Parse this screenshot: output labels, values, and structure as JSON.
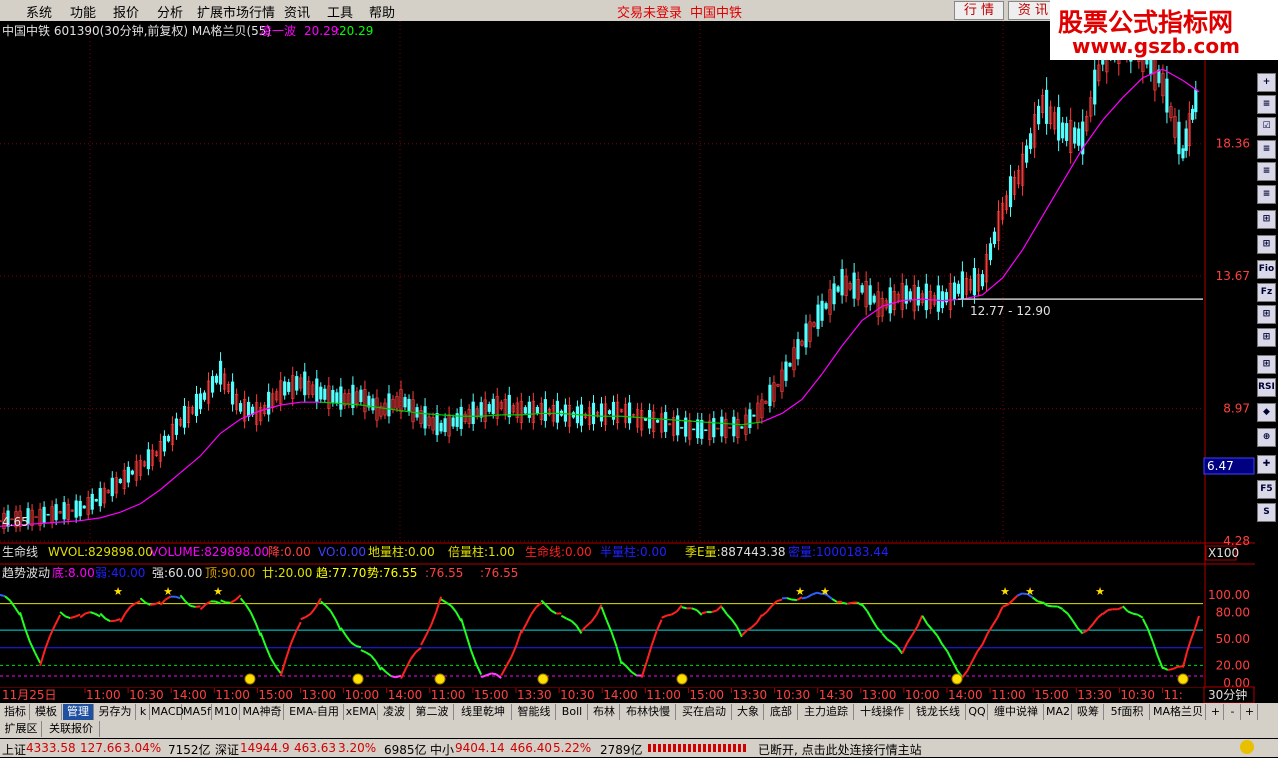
{
  "menu": {
    "items": [
      "系统",
      "功能",
      "报价",
      "分析",
      "扩展市场行情",
      "资讯",
      "工具",
      "帮助"
    ],
    "status_text": "交易未登录",
    "stock_name_top": "中国中铁",
    "buttons": [
      "行 情",
      "资 讯"
    ]
  },
  "watermark": {
    "title": "股票公式指标网",
    "url": "www.gszb.com"
  },
  "main_chart": {
    "title": "中国中铁 601390(30分钟,前复权) MA格兰贝(55)",
    "indicator_name": "凌一波",
    "indicator_values": [
      "20.29",
      "20.29"
    ],
    "y_labels": [
      "18.36",
      "13.67",
      "8.97",
      "4.28"
    ],
    "current_price_label": "6.47",
    "low_label": "4.65",
    "range_label": "12.77 - 12.90",
    "colors": {
      "up": "#ff3c3c",
      "down": "#54ffff",
      "ma_magenta": "#ff00ff",
      "ma_green": "#00cc00"
    }
  },
  "chart_data": [
    {
      "type": "line",
      "title": "中国中铁 601390(30分钟,前复权) MA格兰贝(55)",
      "x": [
        0,
        20,
        40,
        60,
        80,
        100,
        120,
        140,
        160,
        180,
        200,
        220,
        240,
        260,
        280,
        300,
        320,
        340,
        360,
        380,
        400,
        420,
        440,
        460,
        480,
        500,
        520,
        540,
        560,
        580,
        600,
        620,
        640,
        660,
        680,
        700,
        720,
        740,
        760,
        780,
        800,
        820,
        840,
        860,
        880,
        900,
        920,
        940,
        960,
        980,
        1000,
        1020,
        1040,
        1060,
        1080,
        1100,
        1120,
        1140,
        1160,
        1180,
        1196
      ],
      "ylim": [
        4.28,
        22.0
      ],
      "series": [
        {
          "name": "price",
          "values": [
            5.0,
            5.1,
            5.15,
            5.3,
            5.4,
            5.8,
            6.4,
            6.9,
            7.5,
            8.5,
            9.2,
            10.2,
            9.0,
            8.8,
            9.6,
            9.9,
            9.5,
            9.3,
            9.4,
            8.9,
            9.3,
            8.7,
            8.3,
            8.6,
            8.9,
            9.1,
            8.9,
            8.9,
            8.8,
            8.7,
            8.8,
            8.9,
            8.6,
            8.5,
            8.3,
            8.2,
            8.3,
            8.3,
            9.0,
            10.0,
            11.3,
            12.4,
            13.4,
            13.2,
            12.6,
            13.0,
            12.9,
            12.8,
            13.3,
            13.5,
            16.0,
            17.5,
            19.8,
            18.8,
            18.5,
            21.5,
            22.0,
            21.6,
            20.5,
            18.0,
            20.3
          ]
        },
        {
          "name": "MA格兰贝(55)",
          "values": [
            4.8,
            4.85,
            4.9,
            4.95,
            5.0,
            5.1,
            5.3,
            5.6,
            6.1,
            6.7,
            7.3,
            8.1,
            8.6,
            8.9,
            9.1,
            9.2,
            9.2,
            9.15,
            9.1,
            9.0,
            8.9,
            8.8,
            8.75,
            8.7,
            8.7,
            8.75,
            8.75,
            8.8,
            8.8,
            8.75,
            8.7,
            8.7,
            8.65,
            8.6,
            8.55,
            8.5,
            8.45,
            8.4,
            8.5,
            8.8,
            9.3,
            10.2,
            11.2,
            12.1,
            12.6,
            12.8,
            12.85,
            12.8,
            12.85,
            13.0,
            13.6,
            14.6,
            15.8,
            17.0,
            18.2,
            19.2,
            20.0,
            20.7,
            21.0,
            20.6,
            20.2
          ]
        }
      ]
    },
    {
      "type": "line",
      "title": "趋势波动",
      "x": [
        0,
        20,
        40,
        60,
        80,
        100,
        120,
        140,
        160,
        180,
        200,
        220,
        240,
        260,
        280,
        300,
        320,
        340,
        360,
        380,
        400,
        420,
        440,
        460,
        480,
        500,
        520,
        540,
        560,
        580,
        600,
        620,
        640,
        660,
        680,
        700,
        720,
        740,
        760,
        780,
        800,
        820,
        840,
        860,
        880,
        900,
        920,
        940,
        960,
        980,
        1000,
        1020,
        1040,
        1060,
        1080,
        1100,
        1120,
        1140,
        1160,
        1180,
        1196
      ],
      "ylim": [
        0,
        110
      ],
      "series": [
        {
          "name": "趋",
          "values": [
            100,
            80,
            20,
            80,
            75,
            78,
            70,
            95,
            90,
            98,
            85,
            92,
            98,
            55,
            10,
            70,
            95,
            60,
            40,
            15,
            8,
            40,
            98,
            70,
            10,
            5,
            60,
            90,
            80,
            55,
            90,
            20,
            10,
            70,
            90,
            75,
            90,
            50,
            80,
            92,
            100,
            98,
            95,
            85,
            60,
            30,
            80,
            40,
            10,
            40,
            90,
            98,
            95,
            80,
            60,
            75,
            90,
            70,
            20,
            15,
            80
          ]
        }
      ]
    }
  ],
  "volume_row": {
    "label": "生命线",
    "items": [
      {
        "name": "WVOL:",
        "value": "829898.00"
      },
      {
        "name": "VOLUME:",
        "value": "829898.00"
      },
      {
        "name": "降:",
        "value": "0.00"
      },
      {
        "name": "VO:",
        "value": "0.00"
      },
      {
        "name": "地量柱:",
        "value": "0.00"
      },
      {
        "name": "倍量柱:",
        "value": "1.00"
      },
      {
        "name": "生命线:",
        "value": "0.00"
      },
      {
        "name": "半量柱:",
        "value": "0.00"
      },
      {
        "name": "季E量:",
        "value": "887443.38"
      },
      {
        "name": "密量:",
        "value": "1000183.44"
      }
    ],
    "x_button": "X100"
  },
  "wave_row": {
    "label": "趋势波动",
    "items": [
      {
        "name": "底:",
        "value": "8.00"
      },
      {
        "name": "弱:",
        "value": "40.00"
      },
      {
        "name": "强:",
        "value": "60.00"
      },
      {
        "name": "顶:",
        "value": "90.00"
      },
      {
        "name": "廿:",
        "value": "20.00"
      },
      {
        "name": "趋:",
        "value": "77.70"
      },
      {
        "name": "势:",
        "value": "76.55"
      },
      {
        "name": ":",
        "value": "76.55"
      },
      {
        "name": ":",
        "value": "76.55"
      }
    ],
    "y_labels": [
      "100.00",
      "80.00",
      "50.00",
      "20.00",
      "0.00"
    ]
  },
  "time_axis": {
    "date_label": "11月25日",
    "ticks": [
      "11:00",
      "10:30",
      "14:00",
      "11:00",
      "15:00",
      "13:00",
      "10:00",
      "14:00",
      "11:00",
      "15:00",
      "13:30",
      "10:30",
      "14:00",
      "11:00",
      "15:00",
      "13:30",
      "10:30",
      "14:30",
      "13:00",
      "10:00",
      "14:00",
      "11:00",
      "15:00",
      "13:30",
      "10:30",
      "11:"
    ],
    "period": "30分钟"
  },
  "tabs": [
    "指标",
    "模板",
    "管理",
    "另存为",
    "k",
    "MACD",
    "MA5f",
    "M10",
    "MA神奇",
    "EMA-自用",
    "xEMA",
    "凌波",
    "第二波",
    "线里乾坤",
    "智能线",
    "Boll",
    "布林",
    "布林快慢",
    "买在启动",
    "大象",
    "底部",
    "主力追踪",
    "十线操作",
    "钱龙长线",
    "QQ",
    "缠中说禅",
    "MA2",
    "吸筹",
    "5f面积",
    "MA格兰贝"
  ],
  "tabs_row2": [
    "扩展区",
    "关联报价"
  ],
  "tab_nav": [
    "+",
    "-",
    "+"
  ],
  "status": {
    "sh_label": "上证",
    "sh_value": "4333.58",
    "sh_change": "127.66",
    "sh_pct": "3.04%",
    "sh_amount": "7152亿",
    "sz_label": "深证",
    "sz_value": "14944.9",
    "sz_change": "463.63",
    "sz_pct": "3.20%",
    "sz_amount": "6985亿",
    "zx_label": "中小",
    "zx_value": "9404.14",
    "zx_change": "466.40",
    "zx_pct": "5.22%",
    "zx_amount": "2789亿",
    "message": "已断开, 点击此处连接行情主站"
  },
  "side_buttons": [
    "+",
    "≡",
    "☑",
    "≡",
    "≡",
    "≡",
    "⊞",
    "⊞",
    "Fio",
    "Fz",
    "⊞",
    "⊞",
    "⊞",
    "RSI",
    "◆",
    "⊕",
    "✚",
    "F5",
    "S"
  ]
}
